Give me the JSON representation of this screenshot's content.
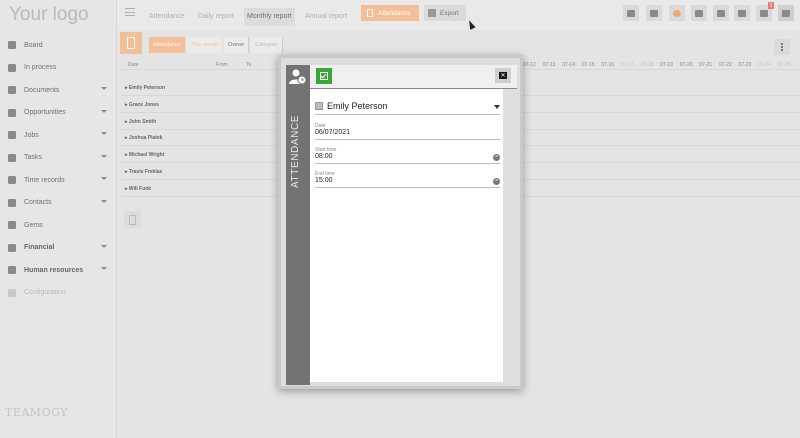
{
  "app": {
    "logo": "Your logo",
    "brand": "TEAMOGY"
  },
  "sidebar": {
    "items": [
      {
        "label": "Board",
        "icon": "grid-icon",
        "chevron": false,
        "style": "normal"
      },
      {
        "label": "In process",
        "icon": "process-icon",
        "chevron": false,
        "style": "normal"
      },
      {
        "label": "Documents",
        "icon": "document-icon",
        "chevron": true,
        "style": "normal"
      },
      {
        "label": "Opportunities",
        "icon": "funnel-icon",
        "chevron": true,
        "style": "normal"
      },
      {
        "label": "Jobs",
        "icon": "gears-icon",
        "chevron": true,
        "style": "normal"
      },
      {
        "label": "Tasks",
        "icon": "tasks-icon",
        "chevron": true,
        "style": "normal"
      },
      {
        "label": "Time records",
        "icon": "clock-icon",
        "chevron": true,
        "style": "normal"
      },
      {
        "label": "Contacts",
        "icon": "contacts-icon",
        "chevron": true,
        "style": "normal"
      },
      {
        "label": "Gems",
        "icon": "diamond-icon",
        "chevron": false,
        "style": "normal"
      },
      {
        "label": "Financial",
        "icon": "dollar-icon",
        "chevron": true,
        "style": "bold"
      },
      {
        "label": "Human resources",
        "icon": "people-icon",
        "chevron": true,
        "style": "bold"
      },
      {
        "label": "Configuration",
        "icon": "gear-icon",
        "chevron": false,
        "style": "muted"
      }
    ]
  },
  "topbar": {
    "tabs": [
      "Attendance",
      "Daily report",
      "Monthly report",
      "Annual report"
    ],
    "active_tab": "Monthly report",
    "attendance_btn": "Attendance",
    "export_btn": "Export",
    "notification_count": "1"
  },
  "subbar": {
    "crumbs": [
      "Attendance",
      "This month",
      "Owner",
      "Category"
    ]
  },
  "table": {
    "columns": {
      "date": "Date",
      "from": "From",
      "to": "To"
    },
    "days": [
      "07-12",
      "07-13",
      "07-14",
      "07-15",
      "07-16",
      "07-17",
      "07-18",
      "07-19",
      "07-20",
      "07-21",
      "07-22",
      "07-23",
      "07-24",
      "07-25"
    ],
    "dim_days": [
      "07-17",
      "07-18",
      "07-24",
      "07-25"
    ],
    "people": [
      "Emily Peterson",
      "Grace Jones",
      "John Smith",
      "Joshua Platek",
      "Michael Wright",
      "Travis Freklas",
      "Will Funk"
    ]
  },
  "modal": {
    "side_label": "ATTENDANCE",
    "person": "Emily Peterson",
    "date_label": "Date",
    "date_value": "06/07/2021",
    "start_label": "Start time",
    "start_value": "08:00",
    "end_label": "End time",
    "end_value": "15:00",
    "close_glyph": "✕",
    "clear_glyph": "×"
  },
  "colors": {
    "accent": "#f4bf98",
    "save": "#3aa53a",
    "modal_side": "#737373"
  }
}
